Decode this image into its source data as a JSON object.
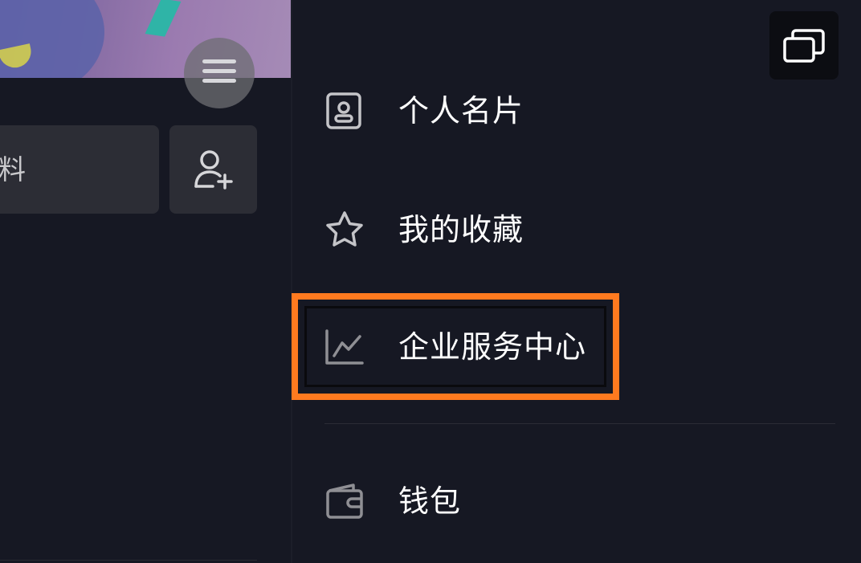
{
  "left_panel": {
    "edit_profile_label": "料"
  },
  "drawer": {
    "items": [
      {
        "label": "个人名片",
        "icon": "person-card-icon"
      },
      {
        "label": "我的收藏",
        "icon": "star-icon"
      },
      {
        "label": "企业服务中心",
        "icon": "line-chart-icon"
      },
      {
        "label": "钱包",
        "icon": "wallet-icon"
      }
    ],
    "highlight_color": "#ff7a1f"
  }
}
